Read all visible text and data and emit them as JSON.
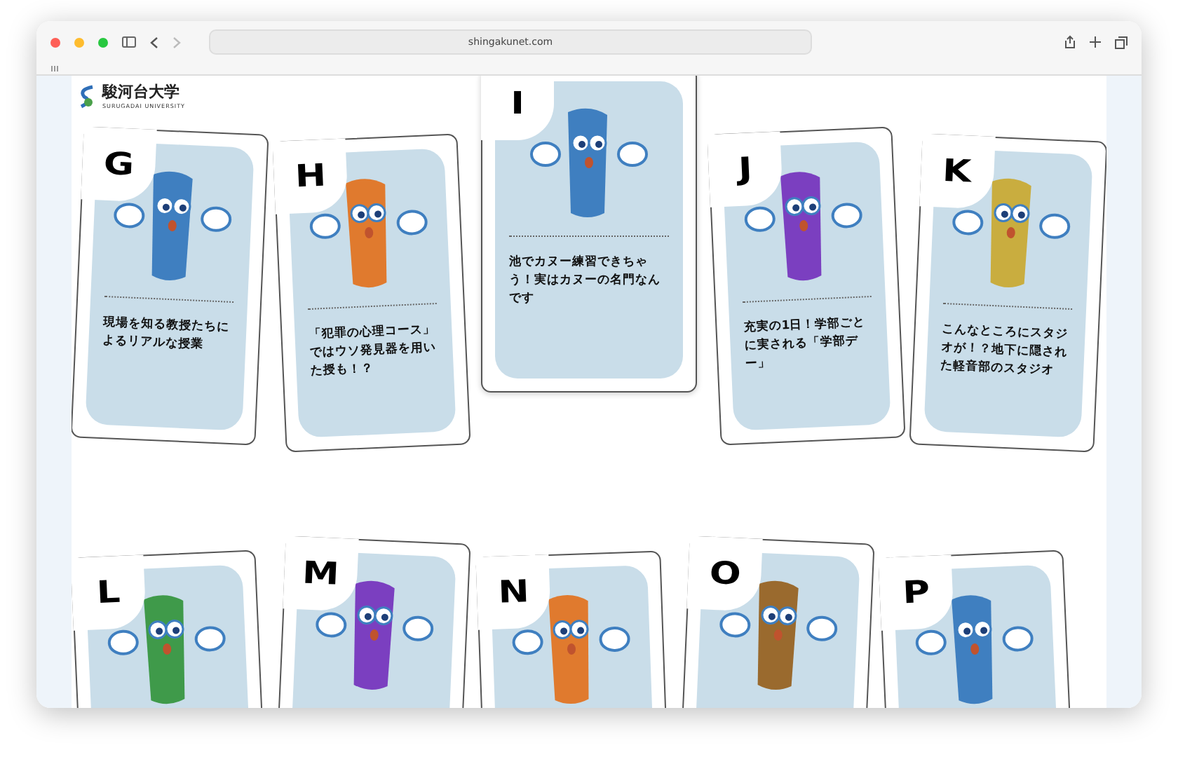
{
  "browser": {
    "url": "shingakunet.com"
  },
  "logo": {
    "name": "駿河台大学",
    "subtitle": "SURUGADAI UNIVERSITY"
  },
  "card_rows": [
    {
      "cards": [
        {
          "letter": "G",
          "color": "#3f7fc0",
          "caption": "現場を知る教授たちによるリアルな授業"
        },
        {
          "letter": "H",
          "color": "#e07a2e",
          "caption": "「犯罪の心理コース」ではウソ発見器を用いた授も！？"
        },
        {
          "letter": "I",
          "color": "#3f7fc0",
          "caption": "池でカヌー練習できちゃう！実はカヌーの名門なんです"
        },
        {
          "letter": "J",
          "color": "#7b3fc0",
          "caption": "充実の1日！学部ごとに実される「学部デー」"
        },
        {
          "letter": "K",
          "color": "#c9ad3f",
          "caption": "こんなところにスタジオが！？地下に隠された軽音部のスタジオ"
        }
      ]
    },
    {
      "cards": [
        {
          "letter": "L",
          "color": "#3f9a4a"
        },
        {
          "letter": "M",
          "color": "#7b3fc0"
        },
        {
          "letter": "N",
          "color": "#e07a2e"
        },
        {
          "letter": "O",
          "color": "#9a6a2e"
        },
        {
          "letter": "P",
          "color": "#3f7fc0"
        }
      ]
    }
  ]
}
